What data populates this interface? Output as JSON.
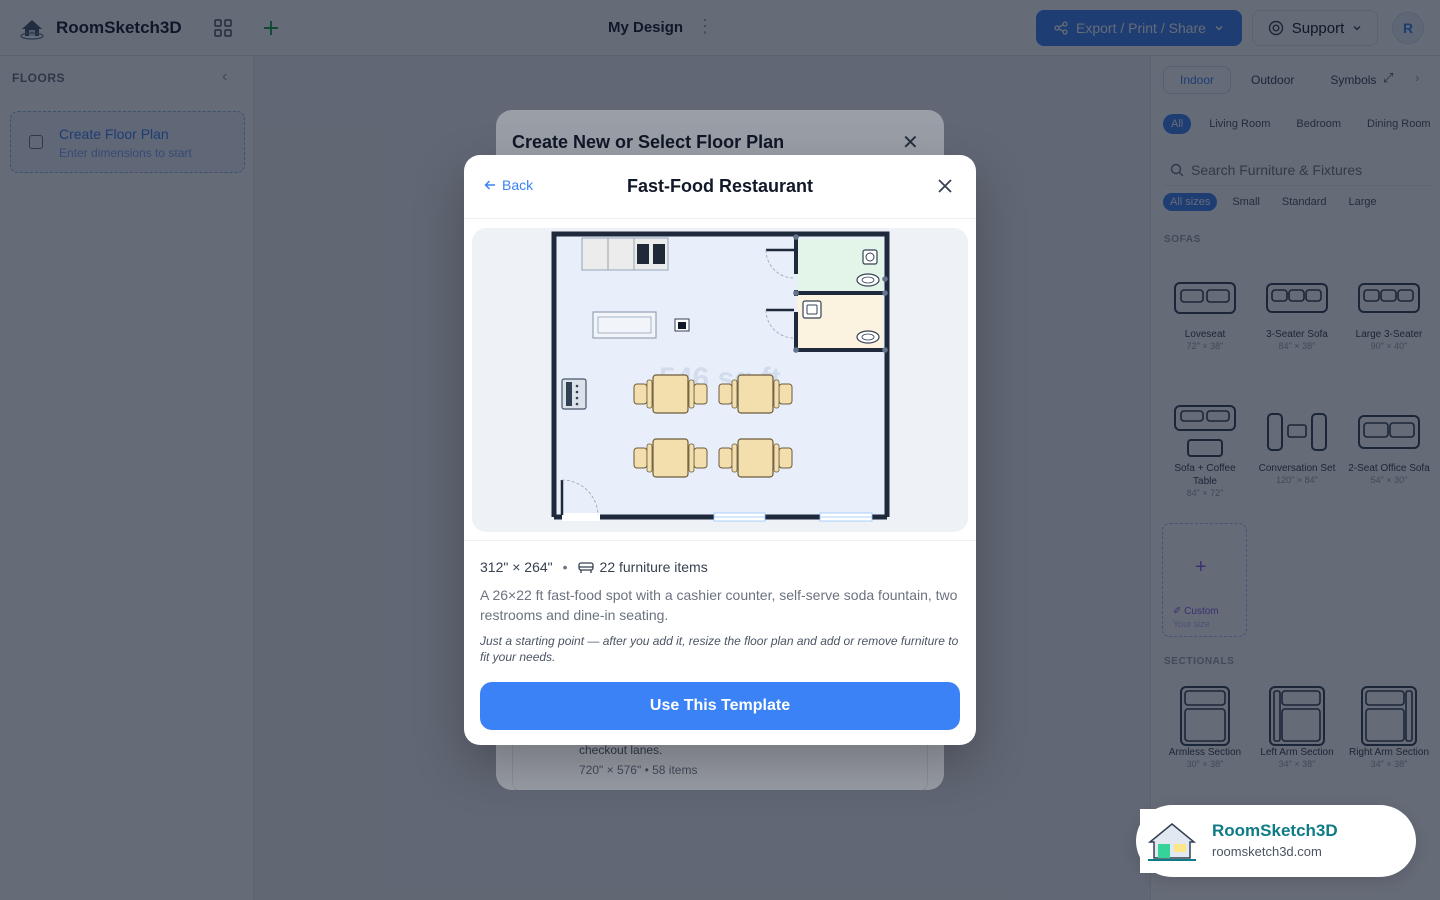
{
  "app": {
    "name": "RoomSketch3D",
    "design_title": "My Design",
    "avatar_initial": "R"
  },
  "header": {
    "export_label": "Export / Print / Share",
    "support_label": "Support"
  },
  "left_panel": {
    "title": "FLOORS",
    "create_title": "Create Floor Plan",
    "create_sub": "Enter dimensions to start"
  },
  "right_panel": {
    "tabs": [
      "Indoor",
      "Outdoor",
      "Symbols"
    ],
    "active_tab": "Indoor",
    "room_chips": [
      "All",
      "Living Room",
      "Bedroom",
      "Dining Room"
    ],
    "search_placeholder": "Search Furniture & Fixtures",
    "size_chips": [
      "All sizes",
      "Small",
      "Standard",
      "Large"
    ],
    "sections": {
      "sofas": "SOFAS",
      "sectionals": "SECTIONALS"
    },
    "sofas": [
      {
        "name": "Loveseat",
        "dims": "72\" × 38\""
      },
      {
        "name": "3-Seater Sofa",
        "dims": "84\" × 38\""
      },
      {
        "name": "Large 3-Seater",
        "dims": "90\" × 40\""
      },
      {
        "name": "Sofa + Coffee Table",
        "dims": "84\" × 72\""
      },
      {
        "name": "Conversation Set",
        "dims": "120\" × 84\""
      },
      {
        "name": "2-Seat Office Sofa",
        "dims": "54\" × 30\""
      }
    ],
    "custom": {
      "label": "Custom",
      "sub": "Your size"
    },
    "sectionals": [
      {
        "name": "Armless Section",
        "dims": "30\" × 38\""
      },
      {
        "name": "Left Arm Section",
        "dims": "34\" × 38\""
      },
      {
        "name": "Right Arm Section",
        "dims": "34\" × 38\""
      }
    ]
  },
  "background_modal": {
    "title": "Create New or Select Floor Plan",
    "card_desc": "checkout lanes.",
    "card_meta": "720\" × 576\" • 58 items"
  },
  "template_modal": {
    "back_label": "Back",
    "title": "Fast-Food Restaurant",
    "area_label": "546 sq ft",
    "dimensions": "312\" × 264\"",
    "separator": "•",
    "furniture_count": "22 furniture items",
    "description": "A 26×22 ft fast-food spot with a cashier counter, self-serve soda fountain, two restrooms and dine-in seating.",
    "note": "Just a starting point — after you add it, resize the floor plan and add or remove furniture to fit your needs.",
    "cta": "Use This Template"
  },
  "badge": {
    "name": "RoomSketch3D",
    "url": "roomsketch3d.com"
  },
  "colors": {
    "accent": "#3b82f6",
    "floor": "#e8effb",
    "wall": "#1e293b",
    "restroom1": "#e3f5e8",
    "restroom2": "#fbf3df",
    "table": "#f3dfae"
  }
}
